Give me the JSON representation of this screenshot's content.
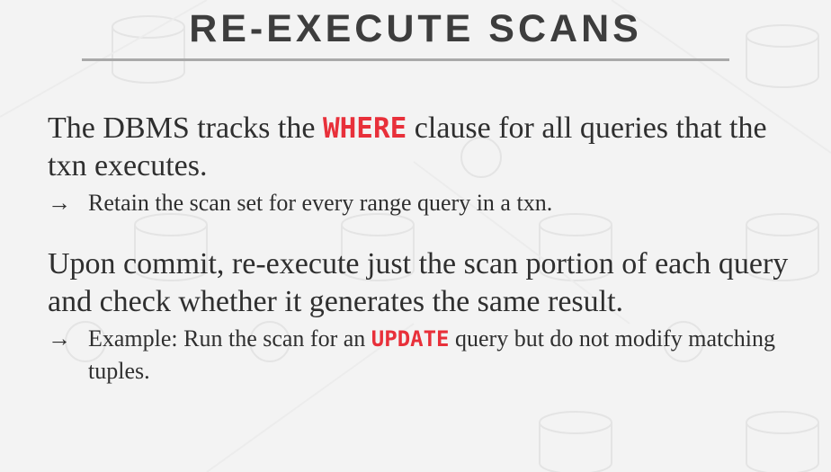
{
  "title": "RE-EXECUTE SCANS",
  "bullets": [
    {
      "pre": "The DBMS tracks the ",
      "kw": "WHERE",
      "post": " clause for all queries that the txn executes.",
      "sub": {
        "arrow": "→",
        "text": "Retain the scan set for every range query in a txn."
      }
    },
    {
      "text": "Upon commit, re-execute just the scan portion of each query and check whether it generates the same result.",
      "sub": {
        "arrow": "→",
        "pre": "Example: Run the scan for an ",
        "kw": "UPDATE",
        "post": " query but do not modify matching tuples."
      }
    }
  ],
  "colors": {
    "keyword": "#e8303a",
    "title": "#3d3d3d",
    "text": "#2f2f2f",
    "rule": "#a9a9a9",
    "background": "#f3f3f3"
  }
}
